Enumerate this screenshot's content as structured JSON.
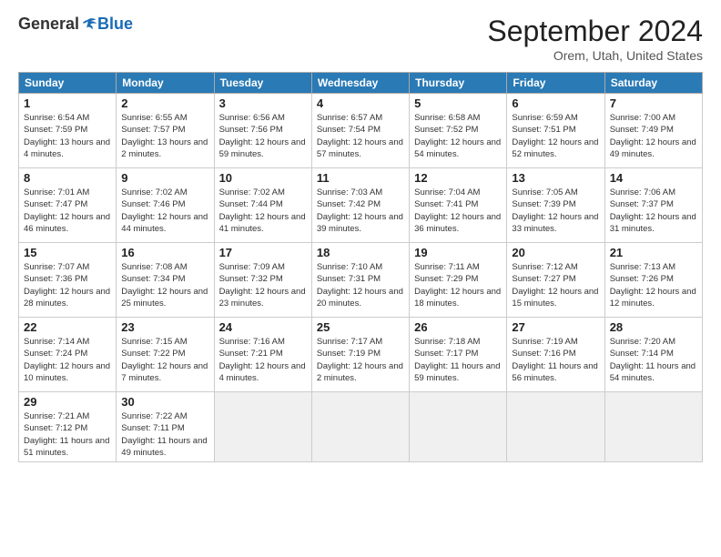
{
  "logo": {
    "general": "General",
    "blue": "Blue"
  },
  "title": "September 2024",
  "location": "Orem, Utah, United States",
  "headers": [
    "Sunday",
    "Monday",
    "Tuesday",
    "Wednesday",
    "Thursday",
    "Friday",
    "Saturday"
  ],
  "weeks": [
    [
      {
        "day": "1",
        "sunrise": "6:54 AM",
        "sunset": "7:59 PM",
        "daylight": "13 hours and 4 minutes."
      },
      {
        "day": "2",
        "sunrise": "6:55 AM",
        "sunset": "7:57 PM",
        "daylight": "13 hours and 2 minutes."
      },
      {
        "day": "3",
        "sunrise": "6:56 AM",
        "sunset": "7:56 PM",
        "daylight": "12 hours and 59 minutes."
      },
      {
        "day": "4",
        "sunrise": "6:57 AM",
        "sunset": "7:54 PM",
        "daylight": "12 hours and 57 minutes."
      },
      {
        "day": "5",
        "sunrise": "6:58 AM",
        "sunset": "7:52 PM",
        "daylight": "12 hours and 54 minutes."
      },
      {
        "day": "6",
        "sunrise": "6:59 AM",
        "sunset": "7:51 PM",
        "daylight": "12 hours and 52 minutes."
      },
      {
        "day": "7",
        "sunrise": "7:00 AM",
        "sunset": "7:49 PM",
        "daylight": "12 hours and 49 minutes."
      }
    ],
    [
      {
        "day": "8",
        "sunrise": "7:01 AM",
        "sunset": "7:47 PM",
        "daylight": "12 hours and 46 minutes."
      },
      {
        "day": "9",
        "sunrise": "7:02 AM",
        "sunset": "7:46 PM",
        "daylight": "12 hours and 44 minutes."
      },
      {
        "day": "10",
        "sunrise": "7:02 AM",
        "sunset": "7:44 PM",
        "daylight": "12 hours and 41 minutes."
      },
      {
        "day": "11",
        "sunrise": "7:03 AM",
        "sunset": "7:42 PM",
        "daylight": "12 hours and 39 minutes."
      },
      {
        "day": "12",
        "sunrise": "7:04 AM",
        "sunset": "7:41 PM",
        "daylight": "12 hours and 36 minutes."
      },
      {
        "day": "13",
        "sunrise": "7:05 AM",
        "sunset": "7:39 PM",
        "daylight": "12 hours and 33 minutes."
      },
      {
        "day": "14",
        "sunrise": "7:06 AM",
        "sunset": "7:37 PM",
        "daylight": "12 hours and 31 minutes."
      }
    ],
    [
      {
        "day": "15",
        "sunrise": "7:07 AM",
        "sunset": "7:36 PM",
        "daylight": "12 hours and 28 minutes."
      },
      {
        "day": "16",
        "sunrise": "7:08 AM",
        "sunset": "7:34 PM",
        "daylight": "12 hours and 25 minutes."
      },
      {
        "day": "17",
        "sunrise": "7:09 AM",
        "sunset": "7:32 PM",
        "daylight": "12 hours and 23 minutes."
      },
      {
        "day": "18",
        "sunrise": "7:10 AM",
        "sunset": "7:31 PM",
        "daylight": "12 hours and 20 minutes."
      },
      {
        "day": "19",
        "sunrise": "7:11 AM",
        "sunset": "7:29 PM",
        "daylight": "12 hours and 18 minutes."
      },
      {
        "day": "20",
        "sunrise": "7:12 AM",
        "sunset": "7:27 PM",
        "daylight": "12 hours and 15 minutes."
      },
      {
        "day": "21",
        "sunrise": "7:13 AM",
        "sunset": "7:26 PM",
        "daylight": "12 hours and 12 minutes."
      }
    ],
    [
      {
        "day": "22",
        "sunrise": "7:14 AM",
        "sunset": "7:24 PM",
        "daylight": "12 hours and 10 minutes."
      },
      {
        "day": "23",
        "sunrise": "7:15 AM",
        "sunset": "7:22 PM",
        "daylight": "12 hours and 7 minutes."
      },
      {
        "day": "24",
        "sunrise": "7:16 AM",
        "sunset": "7:21 PM",
        "daylight": "12 hours and 4 minutes."
      },
      {
        "day": "25",
        "sunrise": "7:17 AM",
        "sunset": "7:19 PM",
        "daylight": "12 hours and 2 minutes."
      },
      {
        "day": "26",
        "sunrise": "7:18 AM",
        "sunset": "7:17 PM",
        "daylight": "11 hours and 59 minutes."
      },
      {
        "day": "27",
        "sunrise": "7:19 AM",
        "sunset": "7:16 PM",
        "daylight": "11 hours and 56 minutes."
      },
      {
        "day": "28",
        "sunrise": "7:20 AM",
        "sunset": "7:14 PM",
        "daylight": "11 hours and 54 minutes."
      }
    ],
    [
      {
        "day": "29",
        "sunrise": "7:21 AM",
        "sunset": "7:12 PM",
        "daylight": "11 hours and 51 minutes."
      },
      {
        "day": "30",
        "sunrise": "7:22 AM",
        "sunset": "7:11 PM",
        "daylight": "11 hours and 49 minutes."
      },
      null,
      null,
      null,
      null,
      null
    ]
  ]
}
